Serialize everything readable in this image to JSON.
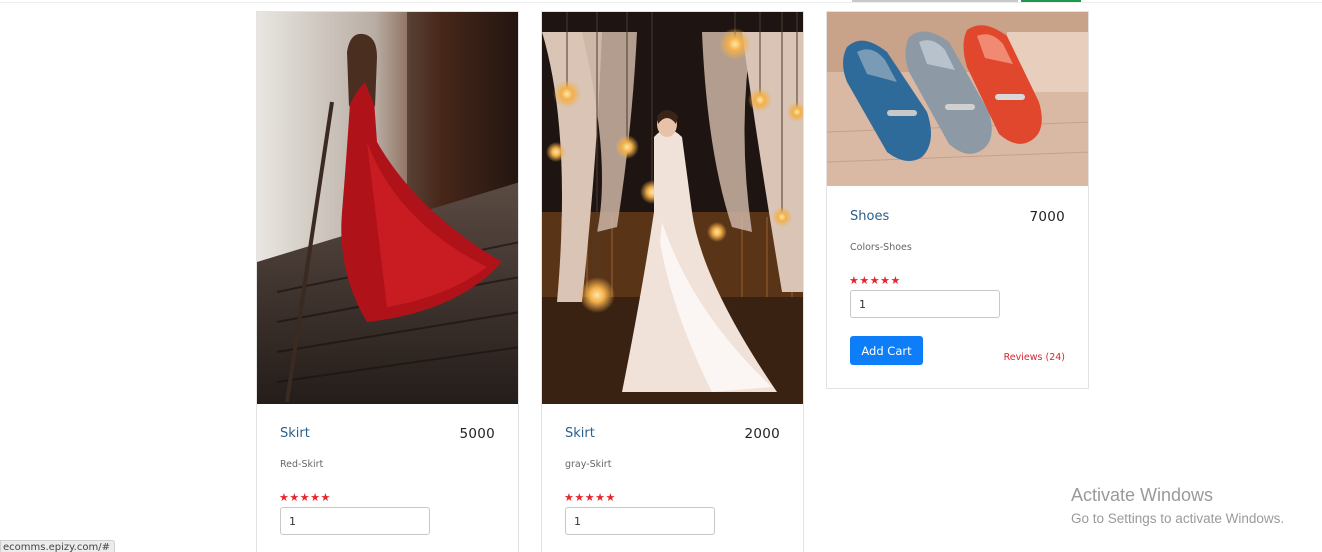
{
  "products": [
    {
      "name": "Skirt",
      "price": "5000",
      "desc": "Red-Skirt",
      "stars": "★★★★★",
      "qty": "1",
      "image": "red-dress-photo"
    },
    {
      "name": "Skirt",
      "price": "2000",
      "desc": "gray-Skirt",
      "stars": "★★★★★",
      "qty": "1",
      "image": "white-gown-photo"
    },
    {
      "name": "Shoes",
      "price": "7000",
      "desc": "Colors-Shoes",
      "stars": "★★★★★",
      "qty": "1",
      "image": "loafers-photo",
      "add_cart_label": "Add Cart",
      "reviews_label": "Reviews (24)"
    }
  ],
  "status_url": "ecomms.epizy.com/#",
  "watermark": {
    "title": "Activate Windows",
    "subtitle": "Go to Settings to activate Windows."
  },
  "colors": {
    "accent": "#0d7ef8",
    "star": "#e8252b",
    "name": "#2a5f8a",
    "reviews": "#d7262c"
  }
}
